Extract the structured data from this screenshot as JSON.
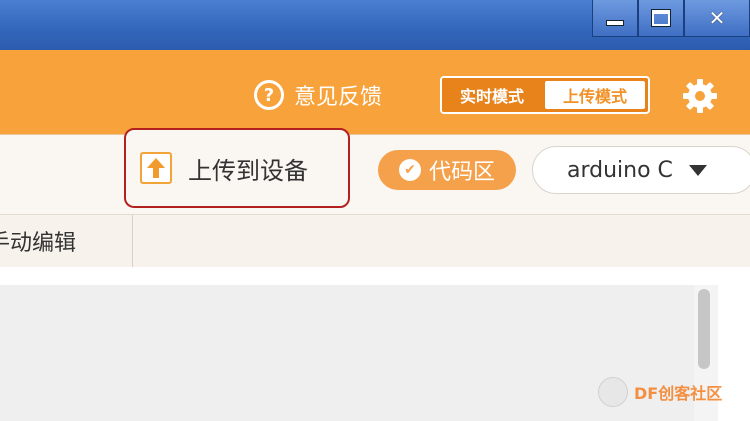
{
  "window_controls": {
    "minimize": "minimize",
    "maximize": "maximize",
    "close": "close"
  },
  "header": {
    "feedback_icon": "?",
    "feedback_label": "意见反馈",
    "mode_toggle": {
      "realtime": "实时模式",
      "upload": "上传模式",
      "selected": "上传模式"
    },
    "settings_icon": "gear-icon"
  },
  "toolbar": {
    "upload_device_label": "上传到设备",
    "code_area_label": "代码区",
    "language_select_value": "arduino C"
  },
  "tabs": [
    {
      "label": "手动编辑"
    }
  ],
  "watermark": {
    "text": "DF创客社区"
  },
  "colors": {
    "accent": "#f7a23a",
    "highlight_border": "#b32020",
    "titlebar": "#3266bb"
  }
}
